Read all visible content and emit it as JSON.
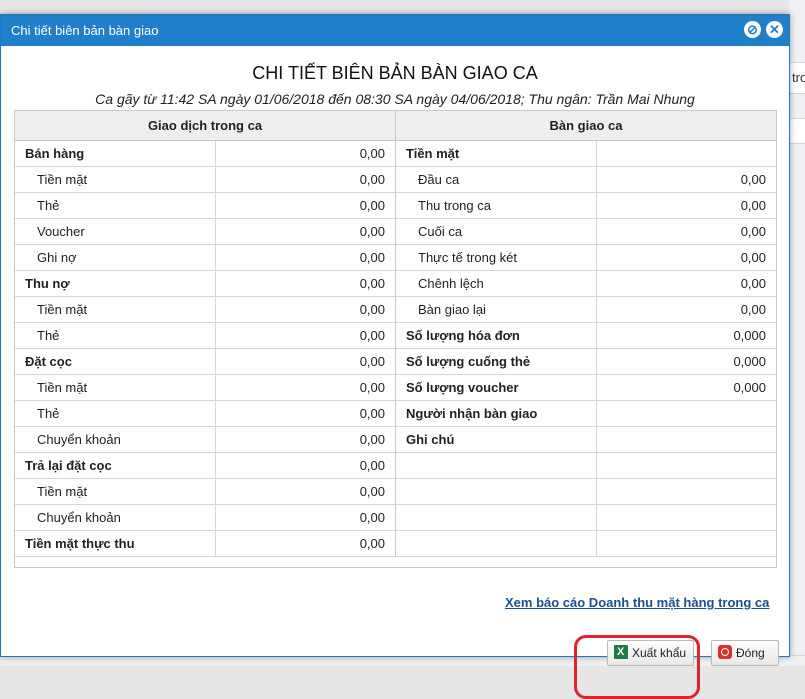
{
  "window": {
    "title": "Chi tiết biên bản bàn giao"
  },
  "report": {
    "title": "CHI TIẾT BIÊN BẢN BÀN GIAO CA",
    "subtitle": "Ca gãy từ 11:42 SA ngày 01/06/2018 đến 08:30 SA ngày 04/06/2018; Thu ngân: Trần Mai Nhung"
  },
  "left": {
    "header": "Giao dịch trong ca",
    "rows": [
      {
        "label": "Bán hàng",
        "value": "0,00"
      },
      {
        "label": "Tiền mặt",
        "value": "0,00"
      },
      {
        "label": "Thẻ",
        "value": "0,00"
      },
      {
        "label": "Voucher",
        "value": "0,00"
      },
      {
        "label": "Ghi nợ",
        "value": "0,00"
      },
      {
        "label": "Thu nợ",
        "value": "0,00"
      },
      {
        "label": "Tiền mặt",
        "value": "0,00"
      },
      {
        "label": "Thẻ",
        "value": "0,00"
      },
      {
        "label": "Đặt cọc",
        "value": "0,00"
      },
      {
        "label": "Tiền mặt",
        "value": "0,00"
      },
      {
        "label": "Thẻ",
        "value": "0,00"
      },
      {
        "label": "Chuyển khoản",
        "value": "0,00"
      },
      {
        "label": "Trả lại đặt cọc",
        "value": "0,00"
      },
      {
        "label": "Tiền mặt",
        "value": "0,00"
      },
      {
        "label": "Chuyển khoản",
        "value": "0,00"
      },
      {
        "label": "Tiền mặt thực thu",
        "value": "0,00"
      }
    ]
  },
  "right": {
    "header": "Bàn giao ca",
    "rows": [
      {
        "label": "Tiền mặt",
        "value": ""
      },
      {
        "label": "Đầu ca",
        "value": "0,00"
      },
      {
        "label": "Thu trong ca",
        "value": "0,00"
      },
      {
        "label": "Cuối ca",
        "value": "0,00"
      },
      {
        "label": "Thực tế trong két",
        "value": "0,00"
      },
      {
        "label": "Chênh lệch",
        "value": "0,00"
      },
      {
        "label": "Bàn giao lại",
        "value": "0,00"
      },
      {
        "label": "Số lượng hóa đơn",
        "value": "0,000"
      },
      {
        "label": "Số lượng cuống thẻ",
        "value": "0,000"
      },
      {
        "label": "Số lượng voucher",
        "value": "0,000"
      },
      {
        "label": "Người nhận bàn giao",
        "value": ""
      },
      {
        "label": "Ghi chú",
        "value": ""
      },
      {
        "label": "",
        "value": ""
      },
      {
        "label": "",
        "value": ""
      },
      {
        "label": "",
        "value": ""
      },
      {
        "label": "",
        "value": ""
      }
    ]
  },
  "footer": {
    "link": "Xem báo cáo Doanh thu mặt hàng trong ca",
    "export_label": "Xuất khẩu",
    "close_label": "Đóng"
  },
  "background": {
    "right_text": "tro"
  },
  "colors": {
    "titlebar": "#1f7fc9",
    "link": "#1a4f91",
    "highlight": "#e0232b"
  }
}
